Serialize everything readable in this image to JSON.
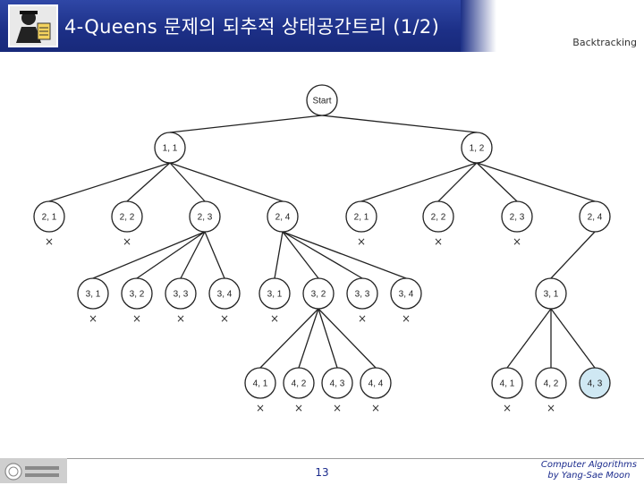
{
  "header": {
    "title": "4-Queens 문제의 되추적 상태공간트리 (1/2)",
    "topic": "Backtracking"
  },
  "footer": {
    "page_number": "13",
    "credit_line1": "Computer Algorithms",
    "credit_line2": "by Yang-Sae Moon"
  },
  "tree": {
    "nodes": [
      {
        "id": "start",
        "label": "Start",
        "parent": null,
        "pruned": false,
        "highlight": false
      },
      {
        "id": "a1",
        "label": "1, 1",
        "parent": "start",
        "pruned": false,
        "highlight": false
      },
      {
        "id": "a2",
        "label": "1, 2",
        "parent": "start",
        "pruned": false,
        "highlight": false
      },
      {
        "id": "b1",
        "label": "2, 1",
        "parent": "a1",
        "pruned": true,
        "highlight": false
      },
      {
        "id": "b2",
        "label": "2, 2",
        "parent": "a1",
        "pruned": true,
        "highlight": false
      },
      {
        "id": "b3",
        "label": "2, 3",
        "parent": "a1",
        "pruned": false,
        "highlight": false
      },
      {
        "id": "b4",
        "label": "2, 4",
        "parent": "a1",
        "pruned": false,
        "highlight": false
      },
      {
        "id": "b5",
        "label": "2, 1",
        "parent": "a2",
        "pruned": true,
        "highlight": false
      },
      {
        "id": "b6",
        "label": "2, 2",
        "parent": "a2",
        "pruned": true,
        "highlight": false
      },
      {
        "id": "b7",
        "label": "2, 3",
        "parent": "a2",
        "pruned": true,
        "highlight": false
      },
      {
        "id": "b8",
        "label": "2, 4",
        "parent": "a2",
        "pruned": false,
        "highlight": false
      },
      {
        "id": "c1",
        "label": "3, 1",
        "parent": "b3",
        "pruned": true,
        "highlight": false
      },
      {
        "id": "c2",
        "label": "3, 2",
        "parent": "b3",
        "pruned": true,
        "highlight": false
      },
      {
        "id": "c3",
        "label": "3, 3",
        "parent": "b3",
        "pruned": true,
        "highlight": false
      },
      {
        "id": "c4",
        "label": "3, 4",
        "parent": "b3",
        "pruned": true,
        "highlight": false
      },
      {
        "id": "c5",
        "label": "3, 1",
        "parent": "b4",
        "pruned": true,
        "highlight": false
      },
      {
        "id": "c6",
        "label": "3, 2",
        "parent": "b4",
        "pruned": false,
        "highlight": false
      },
      {
        "id": "c7",
        "label": "3, 3",
        "parent": "b4",
        "pruned": true,
        "highlight": false
      },
      {
        "id": "c8",
        "label": "3, 4",
        "parent": "b4",
        "pruned": true,
        "highlight": false
      },
      {
        "id": "c9",
        "label": "3, 1",
        "parent": "b8",
        "pruned": false,
        "highlight": false
      },
      {
        "id": "d1",
        "label": "4, 1",
        "parent": "c6",
        "pruned": true,
        "highlight": false
      },
      {
        "id": "d2",
        "label": "4, 2",
        "parent": "c6",
        "pruned": true,
        "highlight": false
      },
      {
        "id": "d3",
        "label": "4, 3",
        "parent": "c6",
        "pruned": true,
        "highlight": false
      },
      {
        "id": "d4",
        "label": "4, 4",
        "parent": "c6",
        "pruned": true,
        "highlight": false
      },
      {
        "id": "d5",
        "label": "4, 1",
        "parent": "c9",
        "pruned": true,
        "highlight": false
      },
      {
        "id": "d6",
        "label": "4, 2",
        "parent": "c9",
        "pruned": true,
        "highlight": false
      },
      {
        "id": "d7",
        "label": "4, 3",
        "parent": "c9",
        "pruned": false,
        "highlight": true
      }
    ],
    "prune_mark": "×",
    "colors": {
      "highlight_fill": "#cfe8f3",
      "node_fill": "#ffffff",
      "stroke": "#222222",
      "title_band": "#1c2f86"
    }
  }
}
